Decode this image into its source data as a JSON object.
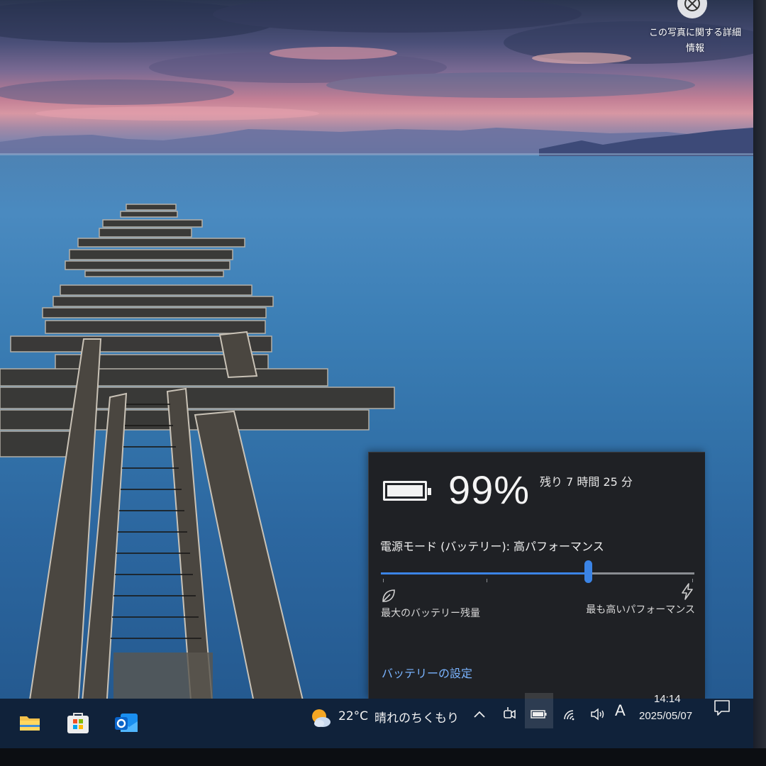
{
  "photo_info": {
    "icon": "camera-info-icon",
    "label": "この写真に関する詳細情報"
  },
  "battery_flyout": {
    "icon": "battery-full-icon",
    "percent": "99%",
    "remaining": "残り 7 時間 25 分",
    "power_mode_label": "電源モード (バッテリー): 高パフォーマンス",
    "slider": {
      "value_fraction": 0.66,
      "min_icon": "leaf-icon",
      "max_icon": "lightning-icon",
      "min_label": "最大のバッテリー残量",
      "max_label": "最も高いパフォーマンス"
    },
    "settings_link": "バッテリーの設定",
    "accent_color": "#3b84e6"
  },
  "taskbar": {
    "apps": [
      {
        "name": "file-explorer-icon"
      },
      {
        "name": "microsoft-store-icon"
      },
      {
        "name": "outlook-icon"
      }
    ],
    "weather": {
      "icon": "partly-cloudy-icon",
      "temperature": "22°C",
      "description": "晴れのちくもり"
    },
    "tray": {
      "icons": [
        "chevron-up-icon",
        "meet-now-icon",
        "battery-icon",
        "wifi-icon",
        "volume-icon"
      ],
      "ime": "A",
      "time": "14:14",
      "date": "2025/05/07",
      "notification_icon": "notification-icon"
    }
  }
}
